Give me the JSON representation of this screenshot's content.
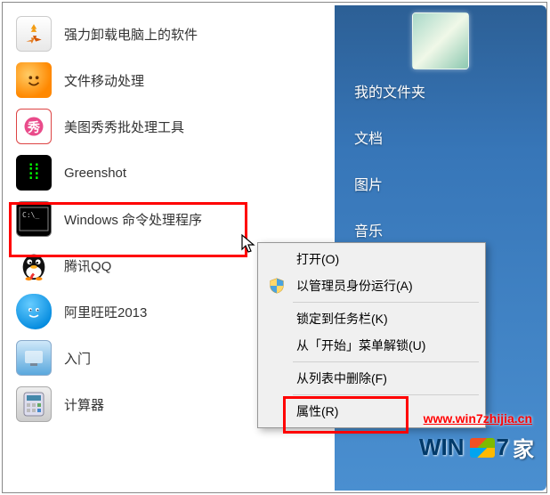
{
  "left_items": [
    {
      "label": "强力卸载电脑上的软件"
    },
    {
      "label": "文件移动处理"
    },
    {
      "label": "美图秀秀批处理工具"
    },
    {
      "label": "Greenshot"
    },
    {
      "label": "Windows 命令处理程序"
    },
    {
      "label": "腾讯QQ"
    },
    {
      "label": "阿里旺旺2013"
    },
    {
      "label": "入门"
    },
    {
      "label": "计算器"
    }
  ],
  "right_items": [
    {
      "label": "我的文件夹"
    },
    {
      "label": "文档"
    },
    {
      "label": "图片"
    },
    {
      "label": "音乐"
    }
  ],
  "context_menu": [
    {
      "label": "打开(O)"
    },
    {
      "label": "以管理员身份运行(A)",
      "icon": "shield"
    },
    {
      "sep": true
    },
    {
      "label": "锁定到任务栏(K)"
    },
    {
      "label": "从「开始」菜单解锁(U)"
    },
    {
      "sep": true
    },
    {
      "label": "从列表中删除(F)"
    },
    {
      "sep": true
    },
    {
      "label": "属性(R)"
    }
  ],
  "watermark_url": "www.win7zhijia.cn",
  "logo": {
    "text": "WIN",
    "seven": "7",
    "cn": "家"
  }
}
